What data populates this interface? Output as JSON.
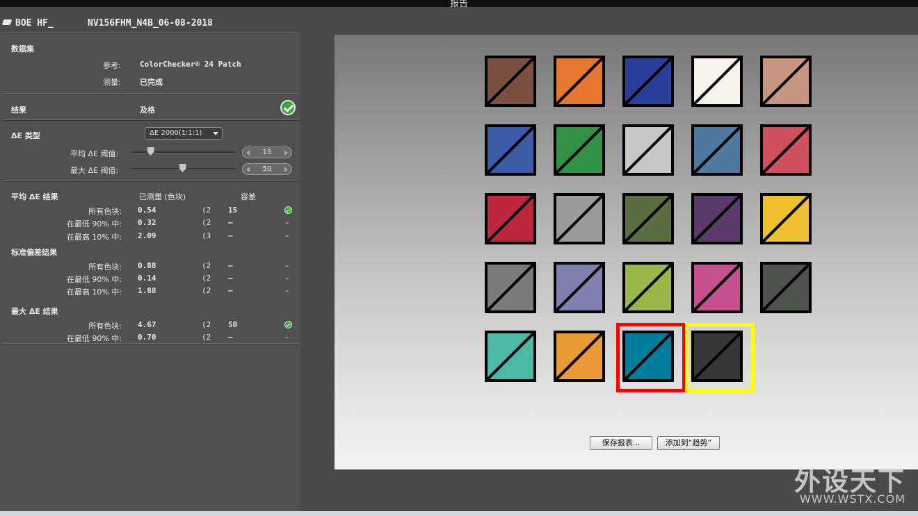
{
  "window": {
    "title": "报告"
  },
  "device": {
    "name": "BOE HF_",
    "model": "NV156FHM_N4B_06-08-2018"
  },
  "dataset": {
    "heading": "数据集",
    "reference_label": "参考:",
    "reference_value": "ColorChecker® 24 Patch",
    "measure_label": "测量:",
    "measure_value": "已完成"
  },
  "result": {
    "label": "结果",
    "value": "及格",
    "status_icon": "check-circle-icon"
  },
  "delta_e": {
    "type_label": "ΔE 类型",
    "type_value": "ΔE 2000(1:1:1)",
    "avg_threshold_label": "平均 ΔE 阈值:",
    "avg_threshold_value": "15",
    "avg_threshold_fraction": 0.18,
    "max_threshold_label": "最大 ΔE 阈值:",
    "max_threshold_value": "50",
    "max_threshold_fraction": 0.49
  },
  "results_table": {
    "col_measured": "已测量 (色块)",
    "col_tolerance": "容差",
    "sections": [
      {
        "title": "平均 ΔE 结果",
        "rows": [
          {
            "label": "所有色块:",
            "value": "0.54",
            "count": "(2",
            "tolerance": "15",
            "status": "check"
          },
          {
            "label": "在最低 90% 中:",
            "value": "0.32",
            "count": "(2",
            "tolerance": "–",
            "status": "–"
          },
          {
            "label": "在最高 10% 中:",
            "value": "2.09",
            "count": "(3",
            "tolerance": "–",
            "status": "–"
          }
        ]
      },
      {
        "title": "标准偏差结果",
        "rows": [
          {
            "label": "所有色块:",
            "value": "0.88",
            "count": "(2",
            "tolerance": "–",
            "status": "–"
          },
          {
            "label": "在最低 90% 中:",
            "value": "0.14",
            "count": "(2",
            "tolerance": "–",
            "status": "–"
          },
          {
            "label": "在最高 10% 中:",
            "value": "1.88",
            "count": "(2",
            "tolerance": "–",
            "status": "–"
          }
        ]
      },
      {
        "title": "最大 ΔE 结果",
        "rows": [
          {
            "label": "所有色块:",
            "value": "4.67",
            "count": "(2",
            "tolerance": "50",
            "status": "check"
          },
          {
            "label": "在最低 90% 中:",
            "value": "0.70",
            "count": "(2",
            "tolerance": "–",
            "status": "–"
          }
        ]
      }
    ]
  },
  "patches": [
    [
      "#7a5040",
      "#e4762e",
      "#2a3f98",
      "#f6f2ec",
      "#c89580"
    ],
    [
      "#3b5aa8",
      "#329247",
      "#c8c8c8",
      "#5079a0",
      "#d0505f"
    ],
    [
      "#be2640",
      "#9a9a9a",
      "#5a6e42",
      "#5a3a6a",
      "#eec030"
    ],
    [
      "#7a7a7a",
      "#8080b0",
      "#9ab84a",
      "#c4508e",
      "#505250"
    ],
    [
      "#4bb8a8",
      "#eb9a38",
      "#007c9c",
      "#363636"
    ]
  ],
  "highlight": {
    "red": [
      4,
      2
    ],
    "yellow": [
      4,
      3
    ],
    "red_color": "#ff0000",
    "yellow_color": "#ffff00"
  },
  "buttons": {
    "save_report": "保存报表...",
    "add_trend": "添加到“趋势”"
  },
  "watermark": {
    "cn": "外设天下",
    "url": "WWW.WSTX.COM"
  }
}
